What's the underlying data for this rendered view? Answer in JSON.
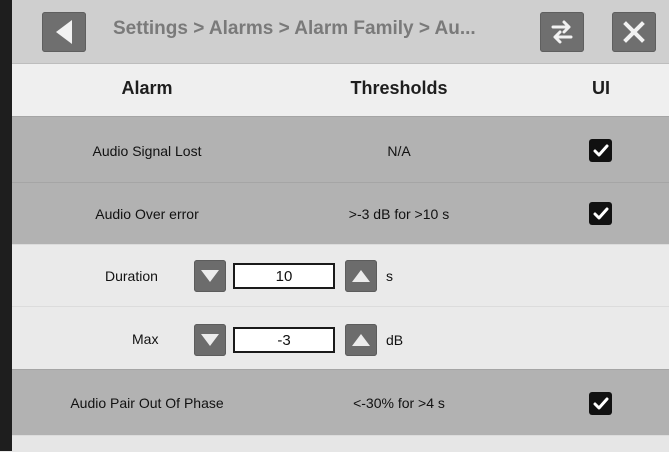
{
  "header": {
    "breadcrumb": "Settings > Alarms > Alarm Family > Au...",
    "columns": {
      "alarm": "Alarm",
      "thresholds": "Thresholds",
      "ui": "UI"
    }
  },
  "rows": [
    {
      "alarm": "Audio Signal Lost",
      "threshold": "N/A",
      "ui_checked": true
    },
    {
      "alarm": "Audio Over error",
      "threshold": ">-3 dB for >10 s",
      "ui_checked": true
    }
  ],
  "settings": {
    "duration": {
      "label": "Duration",
      "value": "10",
      "unit": "s"
    },
    "max": {
      "label": "Max",
      "value": "-3",
      "unit": "dB"
    }
  },
  "row3": {
    "alarm": "Audio Pair Out Of Phase",
    "threshold": "<-30% for >4 s",
    "ui_checked": true
  },
  "colors": {
    "alarm_row_bg": "#b2b2b2",
    "topbar_bg": "#cfcfcf",
    "button_bg": "#6f6f6f"
  },
  "icons": [
    "back-arrow-icon",
    "swap-icon",
    "close-icon",
    "checkbox-checked-icon",
    "arrow-down-icon",
    "arrow-up-icon"
  ]
}
